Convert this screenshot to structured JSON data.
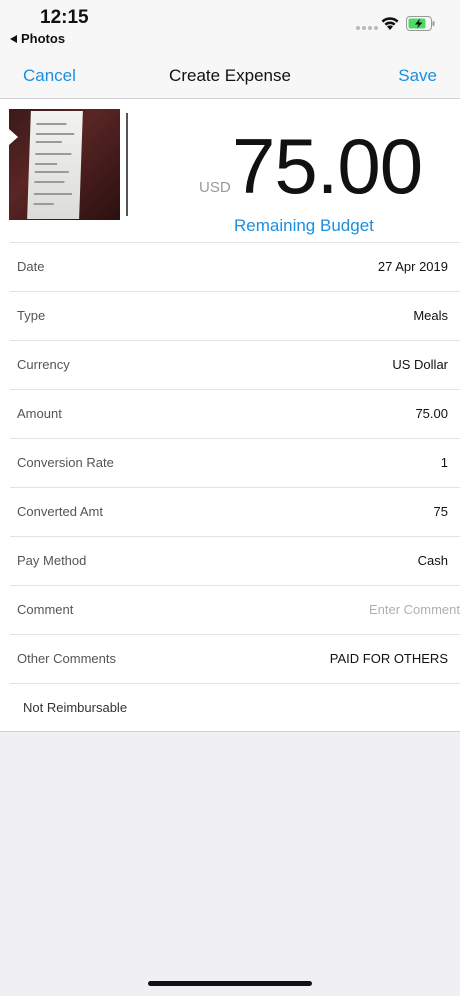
{
  "status_bar": {
    "time": "12:15",
    "back_app": "Photos",
    "wifi_icon": "wifi-icon",
    "battery_icon": "battery-charging-icon",
    "battery_color": "#4cd964"
  },
  "nav": {
    "cancel_label": "Cancel",
    "title": "Create Expense",
    "save_label": "Save",
    "accent_color": "#1a8fe0"
  },
  "summary": {
    "receipt_icon": "receipt-photo",
    "currency_code": "USD",
    "amount": "75.00",
    "remaining_budget_label": "Remaining Budget"
  },
  "fields": [
    {
      "label": "Date",
      "value": "27 Apr 2019"
    },
    {
      "label": "Type",
      "value": "Meals"
    },
    {
      "label": "Currency",
      "value": "US Dollar"
    },
    {
      "label": "Amount",
      "value": "75.00"
    },
    {
      "label": "Conversion Rate",
      "value": "1"
    },
    {
      "label": "Converted Amt",
      "value": "75"
    },
    {
      "label": "Pay Method",
      "value": "Cash"
    },
    {
      "label": "Comment",
      "value": "",
      "placeholder": "Enter Comment"
    },
    {
      "label": "Other Comments",
      "value": "PAID FOR OTHERS"
    },
    {
      "label": "Not Reimbursable",
      "value": ""
    }
  ]
}
